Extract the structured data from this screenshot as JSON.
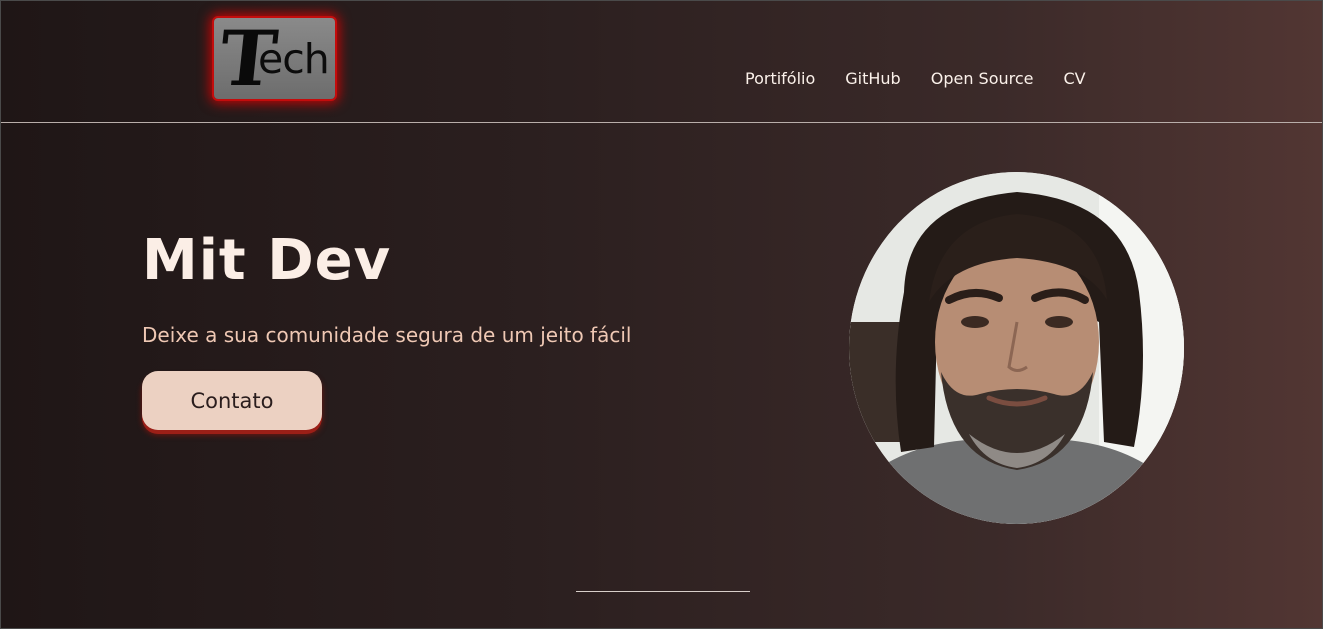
{
  "header": {
    "logo": {
      "big_letter": "T",
      "rest": "ech"
    },
    "nav": [
      {
        "label": "Portifólio"
      },
      {
        "label": "GitHub"
      },
      {
        "label": "Open Source"
      },
      {
        "label": "CV"
      }
    ]
  },
  "hero": {
    "title": "Mit Dev",
    "subtitle": "Deixe a sua comunidade segura de um jeito fácil",
    "cta_label": "Contato"
  },
  "profile_photo": {
    "icon": "profile-photo"
  },
  "colors": {
    "background_dark": "#1f1616",
    "background_light": "#523633",
    "accent_red": "#c40c0c",
    "button_bg": "#ecd1c2",
    "subtitle": "#efc8b4"
  }
}
